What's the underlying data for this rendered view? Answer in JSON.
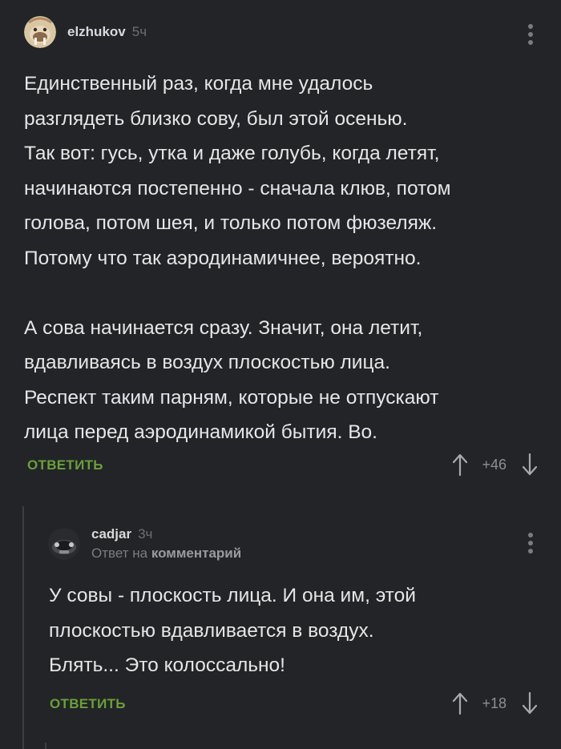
{
  "comments": [
    {
      "username": "elzhukov",
      "time": "5ч",
      "body": "Единственный раз, когда мне удалось\nразглядеть близко сову, был этой осенью.\nТак вот: гусь, утка и даже голубь, когда летят,\nначинаются постепенно - сначала клюв, потом\nголова, потом шея, и только потом фюзеляж.\nПотому что так аэродинамичнее, вероятно.\n\nА сова начинается сразу. Значит, она летит,\nвдавливаясь в воздух плоскостью лица.\nРеспект таким парням, которые не отпускают\nлица перед аэродинамикой бытия. Во.",
      "reply_label": "ОТВЕТИТЬ",
      "rating": "+46"
    },
    {
      "username": "cadjar",
      "time": "3ч",
      "reply_prefix": "Ответ на",
      "reply_target": "комментарий",
      "body": "У совы - плоскость лица. И она им, этой\nплоскостью вдавливается в воздух.\nБлять... Это колоссально!",
      "reply_label": "ОТВЕТИТЬ",
      "rating": "+18"
    }
  ],
  "colors": {
    "background": "#222427",
    "accent": "#6b9f3a",
    "muted": "#6e6f72"
  }
}
